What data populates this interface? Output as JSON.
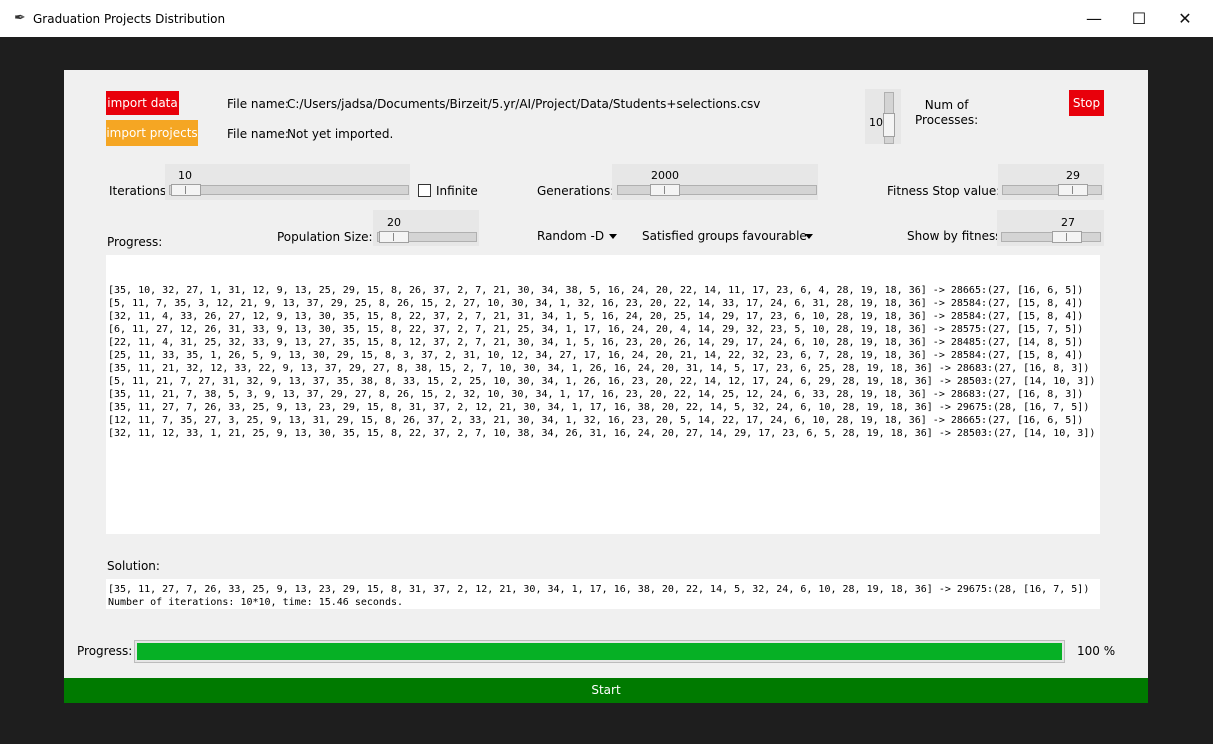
{
  "window": {
    "title": "Graduation Projects Distribution",
    "minimize": "—",
    "maximize": "☐",
    "close": "✕"
  },
  "buttons": {
    "import_data": "import data",
    "import_projects": "import projects",
    "stop": "Stop",
    "start": "Start"
  },
  "files": {
    "label1": "File name:",
    "path1": "C:/Users/jadsa/Documents/Birzeit/5.yr/AI/Project/Data/Students+selections.csv",
    "label2": "File name:",
    "path2": "Not yet imported."
  },
  "processes": {
    "value": "10",
    "label": "Num of\nProcesses:"
  },
  "iterations": {
    "label": "Iterations:",
    "value": "10",
    "infinite_label": "Infinite",
    "infinite_checked": false
  },
  "generations": {
    "label": "Generations:",
    "value": "2000"
  },
  "fitness_stop": {
    "label": "Fitness Stop value:",
    "value": "29"
  },
  "population": {
    "label": "Population Size:",
    "value": "20"
  },
  "selection_method": "Random -D",
  "fitness_mode": "Satisfied groups favourable",
  "show_by_fitness": {
    "label": "Show by fitness:",
    "value": "27"
  },
  "progress_label": "Progress:",
  "log_lines": [
    "[35, 10, 32, 27, 1, 31, 12, 9, 13, 25, 29, 15, 8, 26, 37, 2, 7, 21, 30, 34, 38, 5, 16, 24, 20, 22, 14, 11, 17, 23, 6, 4, 28, 19, 18, 36] -> 28665:(27, [16, 6, 5])",
    "[5, 11, 7, 35, 3, 12, 21, 9, 13, 37, 29, 25, 8, 26, 15, 2, 27, 10, 30, 34, 1, 32, 16, 23, 20, 22, 14, 33, 17, 24, 6, 31, 28, 19, 18, 36] -> 28584:(27, [15, 8, 4])",
    "[32, 11, 4, 33, 26, 27, 12, 9, 13, 30, 35, 15, 8, 22, 37, 2, 7, 21, 31, 34, 1, 5, 16, 24, 20, 25, 14, 29, 17, 23, 6, 10, 28, 19, 18, 36] -> 28584:(27, [15, 8, 4])",
    "[6, 11, 27, 12, 26, 31, 33, 9, 13, 30, 35, 15, 8, 22, 37, 2, 7, 21, 25, 34, 1, 17, 16, 24, 20, 4, 14, 29, 32, 23, 5, 10, 28, 19, 18, 36] -> 28575:(27, [15, 7, 5])",
    "[22, 11, 4, 31, 25, 32, 33, 9, 13, 27, 35, 15, 8, 12, 37, 2, 7, 21, 30, 34, 1, 5, 16, 23, 20, 26, 14, 29, 17, 24, 6, 10, 28, 19, 18, 36] -> 28485:(27, [14, 8, 5])",
    "[25, 11, 33, 35, 1, 26, 5, 9, 13, 30, 29, 15, 8, 3, 37, 2, 31, 10, 12, 34, 27, 17, 16, 24, 20, 21, 14, 22, 32, 23, 6, 7, 28, 19, 18, 36] -> 28584:(27, [15, 8, 4])",
    "[35, 11, 21, 32, 12, 33, 22, 9, 13, 37, 29, 27, 8, 38, 15, 2, 7, 10, 30, 34, 1, 26, 16, 24, 20, 31, 14, 5, 17, 23, 6, 25, 28, 19, 18, 36] -> 28683:(27, [16, 8, 3])",
    "[5, 11, 21, 7, 27, 31, 32, 9, 13, 37, 35, 38, 8, 33, 15, 2, 25, 10, 30, 34, 1, 26, 16, 23, 20, 22, 14, 12, 17, 24, 6, 29, 28, 19, 18, 36] -> 28503:(27, [14, 10, 3])",
    "[35, 11, 21, 7, 38, 5, 3, 9, 13, 37, 29, 27, 8, 26, 15, 2, 32, 10, 30, 34, 1, 17, 16, 23, 20, 22, 14, 25, 12, 24, 6, 33, 28, 19, 18, 36] -> 28683:(27, [16, 8, 3])",
    "[35, 11, 27, 7, 26, 33, 25, 9, 13, 23, 29, 15, 8, 31, 37, 2, 12, 21, 30, 34, 1, 17, 16, 38, 20, 22, 14, 5, 32, 24, 6, 10, 28, 19, 18, 36] -> 29675:(28, [16, 7, 5])",
    "[12, 11, 7, 35, 27, 3, 25, 9, 13, 31, 29, 15, 8, 26, 37, 2, 33, 21, 30, 34, 1, 32, 16, 23, 20, 5, 14, 22, 17, 24, 6, 10, 28, 19, 18, 36] -> 28665:(27, [16, 6, 5])",
    "[32, 11, 12, 33, 1, 21, 25, 9, 13, 30, 35, 15, 8, 22, 37, 2, 7, 10, 38, 34, 26, 31, 16, 24, 20, 27, 14, 29, 17, 23, 6, 5, 28, 19, 18, 36] -> 28503:(27, [14, 10, 3])"
  ],
  "solution_label": "Solution:",
  "solution_text": "[35, 11, 27, 7, 26, 33, 25, 9, 13, 23, 29, 15, 8, 31, 37, 2, 12, 21, 30, 34, 1, 17, 16, 38, 20, 22, 14, 5, 32, 24, 6, 10, 28, 19, 18, 36] -> 29675:(28, [16, 7, 5])\nNumber of iterations: 10*10, time: 15.46 seconds.",
  "bottom_progress": {
    "label": "Progress:",
    "percent_text": "100 %",
    "fraction": 1.0
  },
  "colors": {
    "start_bar": "#007a00",
    "progress_fill": "#06b025",
    "red": "#e8000b",
    "orange": "#f5a623"
  }
}
